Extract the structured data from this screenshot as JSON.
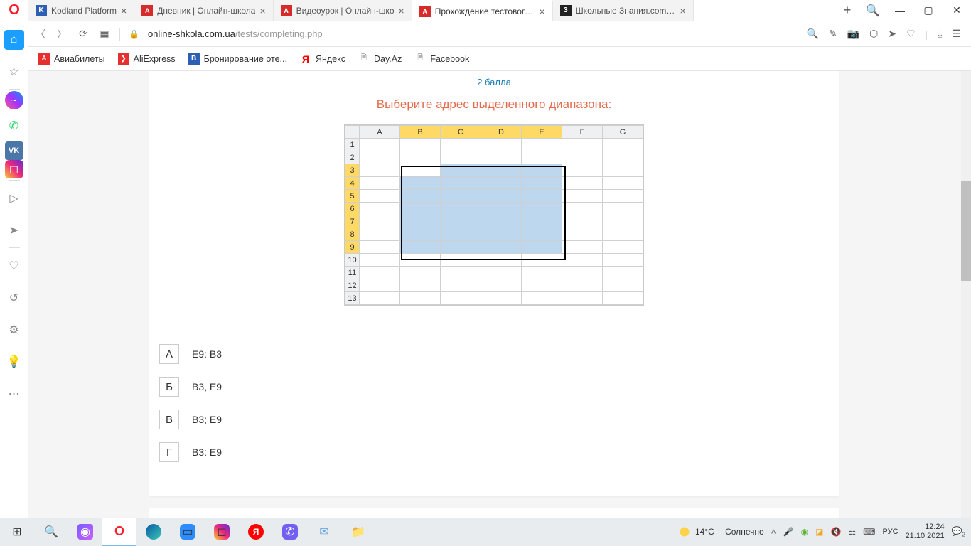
{
  "tabs": [
    {
      "title": "Kodland Platform",
      "icon": "k"
    },
    {
      "title": "Дневник | Онлайн-школа",
      "icon": "a"
    },
    {
      "title": "Видеоурок | Онлайн-шко",
      "icon": "a"
    },
    {
      "title": "Прохождение тестового д",
      "icon": "a",
      "active": true
    },
    {
      "title": "Школьные Знания.com - Р",
      "icon": "z"
    }
  ],
  "url": {
    "domain": "online-shkola.com.ua",
    "path": "/tests/completing.php"
  },
  "bookmarks": [
    {
      "label": "Авиабилеты",
      "ico": "red",
      "glyph": "A"
    },
    {
      "label": "AliExpress",
      "ico": "red",
      "glyph": "❯"
    },
    {
      "label": "Бронирование оте...",
      "ico": "blue",
      "glyph": "B"
    },
    {
      "label": "Яндекс",
      "ico": "y",
      "glyph": "Я"
    },
    {
      "label": "Day.Az",
      "ico": "page",
      "glyph": "🗎"
    },
    {
      "label": "Facebook",
      "ico": "page",
      "glyph": "🗎"
    }
  ],
  "test": {
    "points": "2 балла",
    "question": "Выберите адрес выделенного диапазона:",
    "columns": [
      "A",
      "B",
      "C",
      "D",
      "E",
      "F",
      "G"
    ],
    "rows": [
      "1",
      "2",
      "3",
      "4",
      "5",
      "6",
      "7",
      "8",
      "9",
      "10",
      "11",
      "12",
      "13"
    ],
    "selection": {
      "colStart": 1,
      "colEnd": 4,
      "rowStart": 2,
      "rowEnd": 8
    },
    "answers": [
      {
        "letter": "А",
        "text": "E9: B3"
      },
      {
        "letter": "Б",
        "text": "B3, E9"
      },
      {
        "letter": "В",
        "text": "B3; E9"
      },
      {
        "letter": "Г",
        "text": "B3: E9"
      }
    ]
  },
  "weather": {
    "temp": "14°C",
    "desc": "Солнечно"
  },
  "lang": "РУС",
  "clock": {
    "time": "12:24",
    "date": "21.10.2021"
  },
  "notif_count": "2"
}
